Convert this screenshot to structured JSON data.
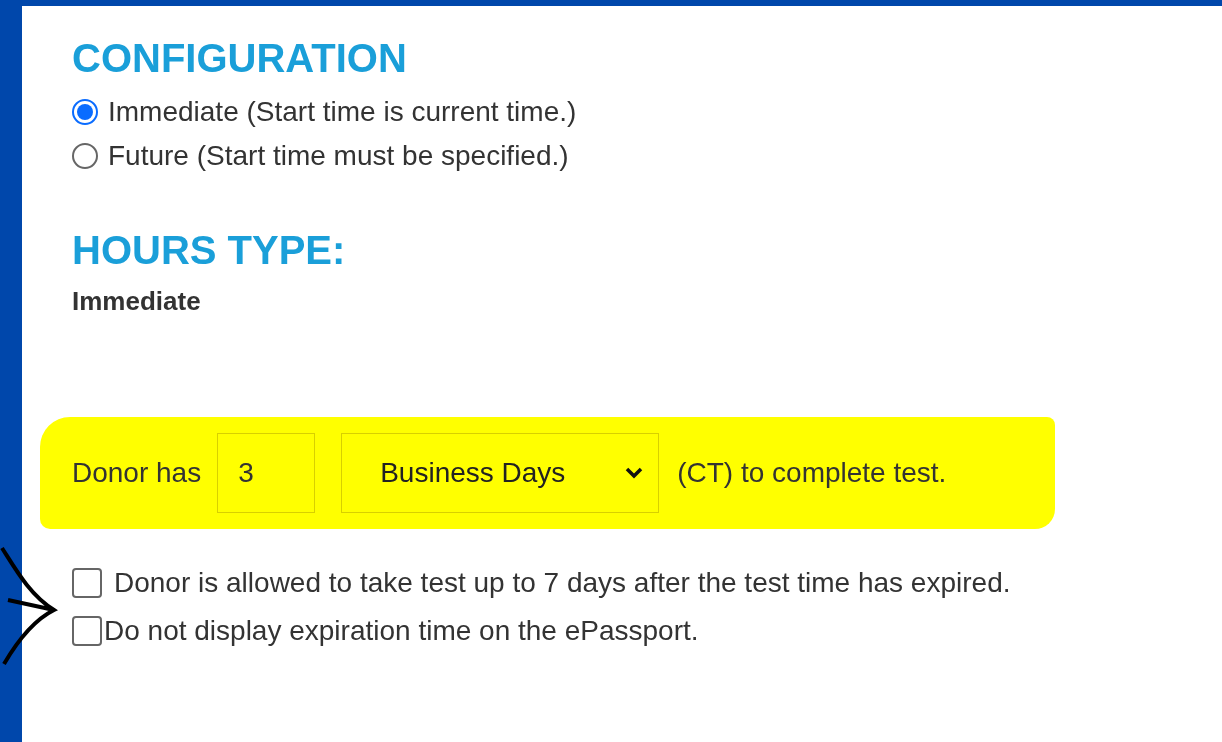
{
  "configuration": {
    "heading": "CONFIGURATION",
    "options": [
      {
        "label": "Immediate (Start time is current time.)",
        "selected": true
      },
      {
        "label": "Future (Start time must be specified.)",
        "selected": false
      }
    ]
  },
  "hours_type": {
    "heading": "HOURS TYPE:",
    "value": "Immediate"
  },
  "duration": {
    "prefix": "Donor has",
    "amount": "3",
    "unit": "Business Days",
    "suffix": "(CT) to complete test."
  },
  "options": [
    {
      "label": "Donor is allowed to take test up to 7 days after the test time has expired.",
      "checked": false
    },
    {
      "label": "Do not display expiration time on the ePassport.",
      "checked": false
    }
  ]
}
